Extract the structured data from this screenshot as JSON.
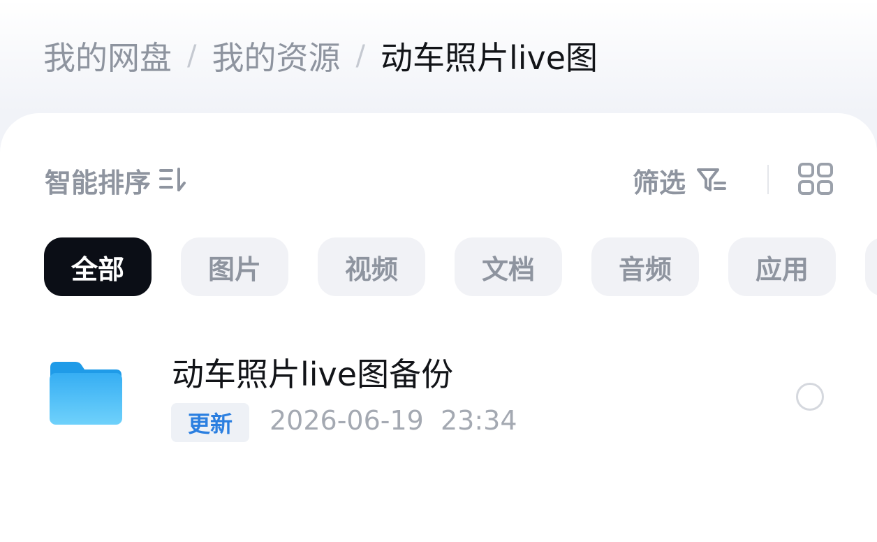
{
  "breadcrumb": {
    "items": [
      "我的网盘",
      "我的资源",
      "动车照片live图"
    ],
    "separator": "/"
  },
  "toolbar": {
    "sort_label": "智能排序",
    "sort_icon": "sort-desc-icon",
    "filter_label": "筛选",
    "filter_icon": "filter-icon",
    "view_toggle_icon": "grid-view-icon"
  },
  "categories": {
    "items": [
      "全部",
      "图片",
      "视频",
      "文档",
      "音频",
      "应用"
    ],
    "selected": "全部"
  },
  "files": [
    {
      "icon": "folder-icon",
      "name": "动车照片live图备份",
      "badge": "更新",
      "modified": "2026-06-19  23:34"
    }
  ],
  "colors": {
    "active_chip": "#0b0e16",
    "folder_blue": "#3fb8f5",
    "badge_text": "#2b7fe0"
  }
}
